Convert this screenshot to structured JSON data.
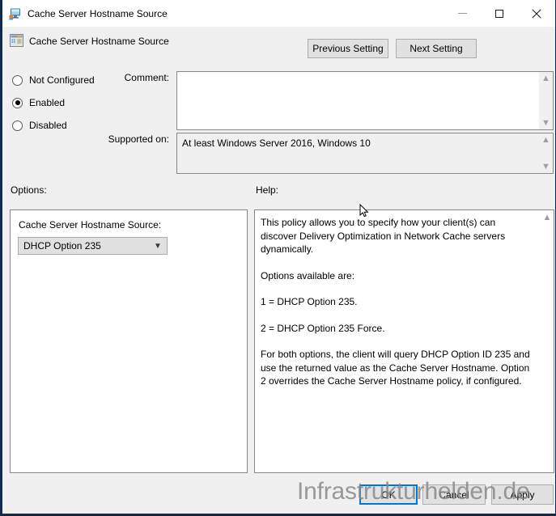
{
  "window": {
    "title": "Cache Server Hostname Source",
    "icon": "computer-monitor-icon",
    "minimize_label": "Minimize",
    "maximize_label": "Maximize",
    "close_label": "Close"
  },
  "header": {
    "icon": "policy-setting-icon",
    "title": "Cache Server Hostname Source",
    "previous_button": "Previous Setting",
    "next_button": "Next Setting"
  },
  "state": {
    "options": [
      "Not Configured",
      "Enabled",
      "Disabled"
    ],
    "selected": "Enabled"
  },
  "comment": {
    "label": "Comment:",
    "value": "",
    "scroll_up_icon": "chevron-up-icon",
    "scroll_down_icon": "chevron-down-icon"
  },
  "supported_on": {
    "label": "Supported on:",
    "value": "At least Windows Server 2016, Windows 10",
    "scroll_up_icon": "chevron-up-icon",
    "scroll_down_icon": "chevron-down-icon"
  },
  "options_section": {
    "label": "Options:",
    "field_label": "Cache Server Hostname Source:",
    "selected_value": "DHCP Option 235",
    "dropdown_icon": "chevron-down-icon",
    "choices": [
      "DHCP Option 235",
      "DHCP Option 235 Force"
    ]
  },
  "help_section": {
    "label": "Help:",
    "scroll_up_icon": "chevron-up-icon",
    "paragraphs": [
      "This policy allows you to specify how your client(s) can discover Delivery Optimization in Network Cache servers dynamically.",
      "Options available are:",
      "1 = DHCP Option 235.",
      "2 = DHCP Option 235 Force.",
      "For both options, the client will query DHCP Option ID 235 and use the returned value as the Cache Server Hostname. Option 2 overrides the Cache Server Hostname policy, if configured."
    ]
  },
  "footer": {
    "ok_label": "OK",
    "cancel_label": "Cancel",
    "apply_label": "Apply"
  },
  "watermark": {
    "text": "Infrastrukturhelden.de"
  },
  "colors": {
    "window_border": "#15294b",
    "titlebar_bg": "#ffffff",
    "dialog_bg": "#f0f0f0",
    "button_bg": "#e1e1e1",
    "button_border": "#adadad",
    "focus_border": "#0078d7",
    "field_border": "#888888",
    "watermark_gray": "#8a8a8a"
  }
}
